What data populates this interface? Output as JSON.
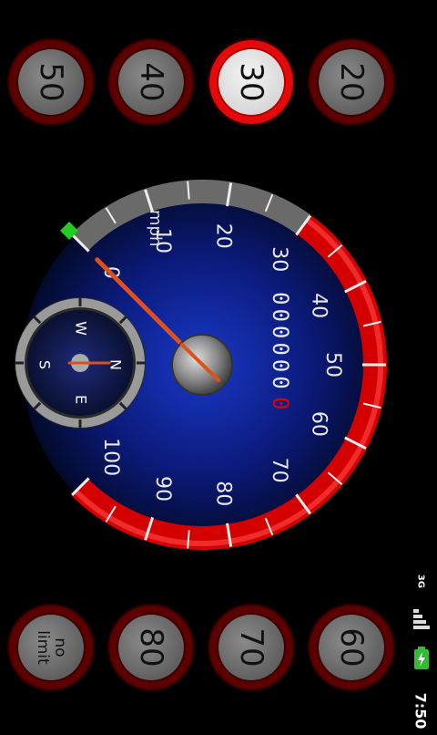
{
  "speed_limits_top": [
    {
      "label": "50",
      "active": false
    },
    {
      "label": "40",
      "active": false
    },
    {
      "label": "30",
      "active": true
    },
    {
      "label": "20",
      "active": false
    }
  ],
  "speed_limits_bottom": [
    {
      "label": "no\nlimit",
      "active": false
    },
    {
      "label": "80",
      "active": false
    },
    {
      "label": "70",
      "active": false
    },
    {
      "label": "60",
      "active": false
    }
  ],
  "gauge": {
    "unit": "mph",
    "scale_labels": [
      "0",
      "10",
      "20",
      "30",
      "40",
      "50",
      "60",
      "70",
      "80",
      "90",
      "100"
    ],
    "odometer": "000000",
    "odometer_tenths": "0",
    "current_speed": 0,
    "accent_color": "#e00000"
  },
  "compass": {
    "n": "N",
    "e": "E",
    "s": "S",
    "w": "W",
    "heading_deg": 0
  },
  "status_bar": {
    "network": "3G",
    "time": "7:50",
    "battery_icon": "battery-charging-icon",
    "signal_icon": "signal-bars-icon"
  }
}
